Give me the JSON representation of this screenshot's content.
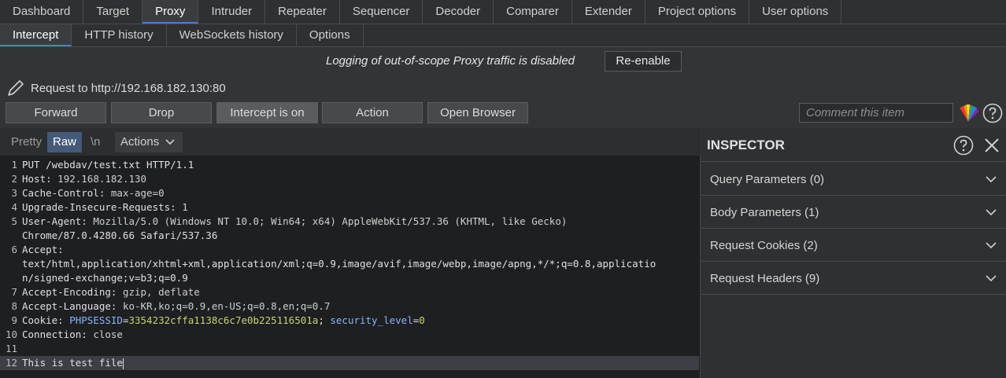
{
  "main_tabs": [
    "Dashboard",
    "Target",
    "Proxy",
    "Intruder",
    "Repeater",
    "Sequencer",
    "Decoder",
    "Comparer",
    "Extender",
    "Project options",
    "User options"
  ],
  "sub_tabs": [
    "Intercept",
    "HTTP history",
    "WebSockets history",
    "Options"
  ],
  "notice": {
    "message": "Logging of out-of-scope Proxy traffic is disabled",
    "button": "Re-enable"
  },
  "request": {
    "label": "Request to http://192.168.182.130:80"
  },
  "toolbar": {
    "forward": "Forward",
    "drop": "Drop",
    "intercept": "Intercept is on",
    "action": "Action",
    "open_browser": "Open Browser",
    "comment_placeholder": "Comment this item"
  },
  "editor": {
    "pretty": "Pretty",
    "raw": "Raw",
    "newline": "\\n",
    "actions": "Actions",
    "lines": {
      "l1": "PUT /webdav/test.txt HTTP/1.1",
      "l2k": "Host",
      "l2v": "192.168.182.130",
      "l3k": "Cache-Control",
      "l3v": "max-age=0",
      "l4k": "Upgrade-Insecure-Requests",
      "l4v": "1",
      "l5k": "User-Agent",
      "l5v": "Mozilla/5.0 (Windows NT 10.0; Win64; x64) AppleWebKit/537.36 (KHTML, like Gecko)",
      "l5b": "Chrome/87.0.4280.66 Safari/537.36",
      "l6k": "Accept",
      "l6a": "text/html,application/xhtml+xml,application/xml;q=0.9,image/avif,image/webp,image/apng,*/*;q=0.8,applicatio",
      "l6b": "n/signed-exchange;v=b3;q=0.9",
      "l7k": "Accept-Encoding",
      "l7v": "gzip, deflate",
      "l8k": "Accept-Language",
      "l8v": "ko-KR,ko;q=0.9,en-US;q=0.8,en;q=0.7",
      "l9k": "Cookie",
      "c1n": "PHPSESSID",
      "c1v": "3354232cffa1138c6c7e0b225116501a",
      "c2n": "security_level",
      "c2v": "0",
      "l10k": "Connection",
      "l10v": "close",
      "l12": "This is test file"
    }
  },
  "inspector": {
    "title": "INSPECTOR",
    "sections": [
      "Query Parameters (0)",
      "Body Parameters (1)",
      "Request Cookies (2)",
      "Request Headers (9)"
    ]
  }
}
